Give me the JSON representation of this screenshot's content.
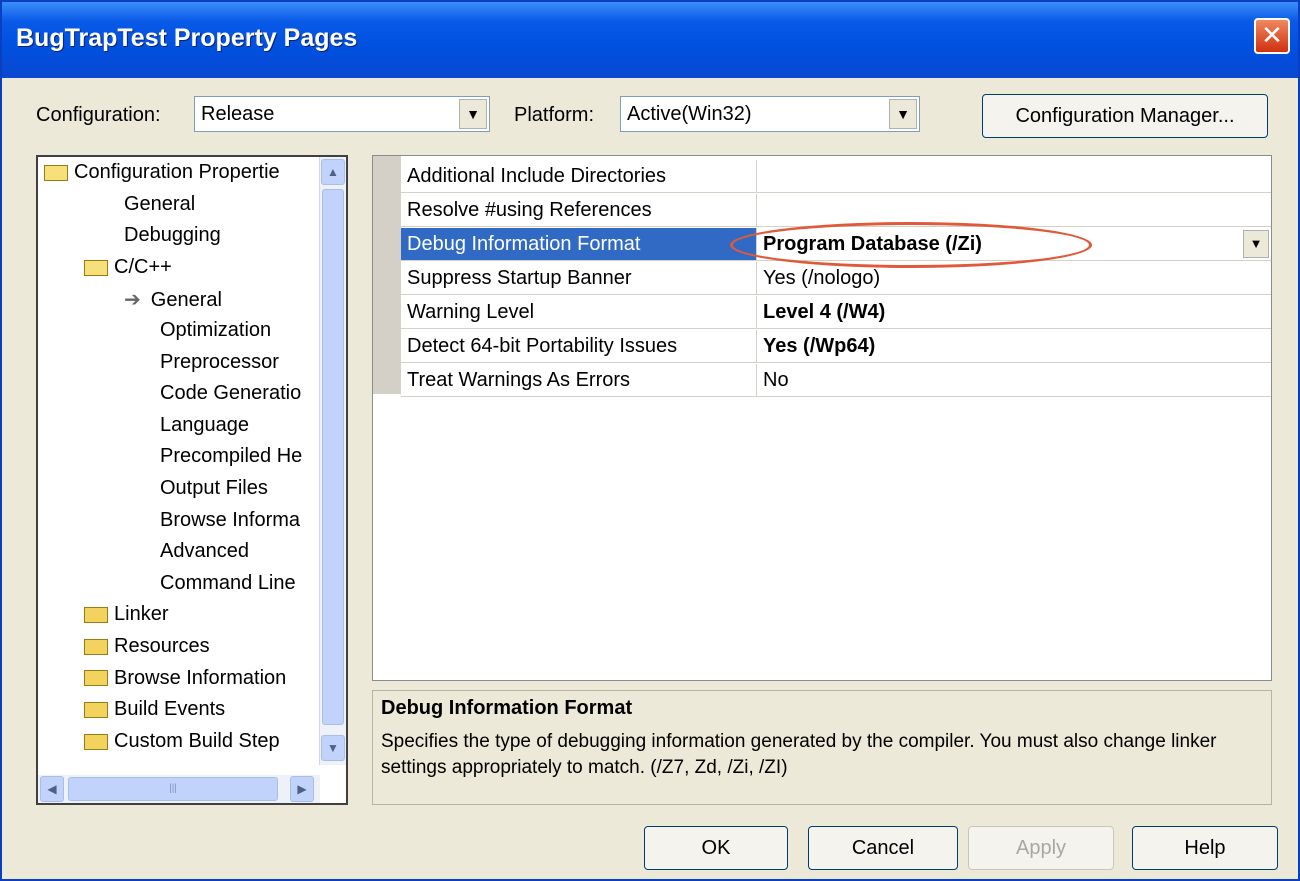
{
  "window": {
    "title": "BugTrapTest Property Pages",
    "close_glyph": "✕"
  },
  "toolbar": {
    "configuration_label": "Configuration:",
    "configuration_value": "Release",
    "platform_label": "Platform:",
    "platform_value": "Active(Win32)",
    "config_manager_label": "Configuration Manager..."
  },
  "tree": {
    "items": [
      {
        "label": "Configuration Propertie",
        "icon": "folder-open-icon"
      },
      {
        "label": "General"
      },
      {
        "label": "Debugging"
      },
      {
        "label": "C/C++",
        "icon": "folder-open-icon"
      },
      {
        "label": "General",
        "icon": "arrow-right-icon",
        "selected": true
      },
      {
        "label": "Optimization"
      },
      {
        "label": "Preprocessor"
      },
      {
        "label": "Code Generatio"
      },
      {
        "label": "Language"
      },
      {
        "label": "Precompiled He"
      },
      {
        "label": "Output Files"
      },
      {
        "label": "Browse Informa"
      },
      {
        "label": "Advanced"
      },
      {
        "label": "Command Line"
      },
      {
        "label": "Linker",
        "icon": "folder-icon"
      },
      {
        "label": "Resources",
        "icon": "folder-icon"
      },
      {
        "label": "Browse Information",
        "icon": "folder-icon"
      },
      {
        "label": "Build Events",
        "icon": "folder-icon"
      },
      {
        "label": "Custom Build Step",
        "icon": "folder-icon"
      }
    ]
  },
  "grid": {
    "rows": [
      {
        "name": "Additional Include Directories",
        "value": ""
      },
      {
        "name": "Resolve #using References",
        "value": ""
      },
      {
        "name": "Debug Information Format",
        "value": "Program Database (/Zi)",
        "bold": true,
        "selected": true
      },
      {
        "name": "Suppress Startup Banner",
        "value": "Yes (/nologo)"
      },
      {
        "name": "Warning Level",
        "value": "Level 4 (/W4)",
        "bold": true
      },
      {
        "name": "Detect 64-bit Portability Issues",
        "value": "Yes (/Wp64)",
        "bold": true
      },
      {
        "name": "Treat Warnings As Errors",
        "value": "No"
      }
    ]
  },
  "description": {
    "title": "Debug Information Format",
    "text": "Specifies the type of debugging information generated by the compiler.  You must also change linker settings appropriately to match.    (/Z7, Zd, /Zi, /ZI)"
  },
  "buttons": {
    "ok": "OK",
    "cancel": "Cancel",
    "apply": "Apply",
    "help": "Help"
  },
  "colors": {
    "title_bar": "#0054e3",
    "selection": "#316ac5",
    "annotation_ring": "#e05a3a"
  }
}
